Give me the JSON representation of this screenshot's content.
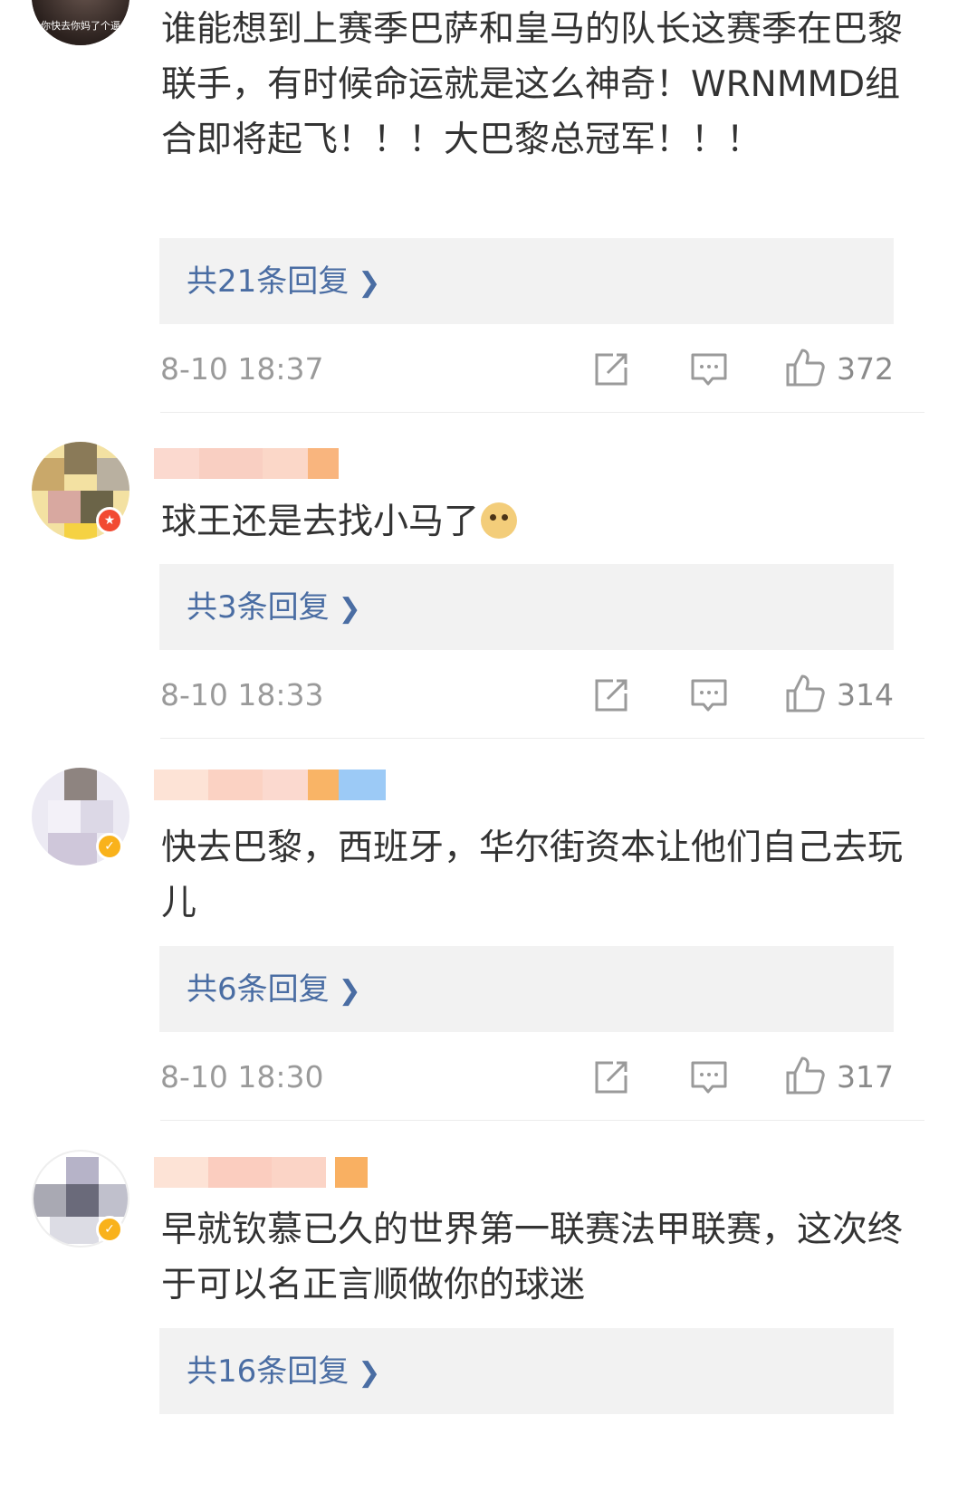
{
  "comments": [
    {
      "text": "谁能想到上赛季巴萨和皇马的队长这赛季在巴黎联手，有时候命运就是这么神奇！WRNMMD组合即将起飞！！！大巴黎总冠军！！！",
      "avatar_caption": "你快去你妈了个逼",
      "replies_label": "共21条回复",
      "timestamp": "8-10 18:37",
      "likes": "372"
    },
    {
      "text": "球王还是去找小马了",
      "emoji": "doge-emoji",
      "badge": "red",
      "replies_label": "共3条回复",
      "timestamp": "8-10 18:33",
      "likes": "314"
    },
    {
      "text": "快去巴黎，西班牙，华尔街资本让他们自己去玩儿",
      "badge": "gold",
      "replies_label": "共6条回复",
      "timestamp": "8-10 18:30",
      "likes": "317"
    },
    {
      "text": "早就钦慕已久的世界第一联赛法甲联赛，这次终于可以名正言顺做你的球迷",
      "badge": "gold",
      "replies_label": "共16条回复"
    }
  ],
  "icons": {
    "repost": "repost-icon",
    "comment": "comment-icon",
    "like": "thumbs-up-icon",
    "chevron": "chevron-right-icon"
  },
  "colors": {
    "link": "#4a6da3",
    "meta": "#9a9a9a",
    "reply_bg": "#f2f2f2",
    "badge_red": "#f24a32",
    "badge_gold": "#f9b21b"
  }
}
